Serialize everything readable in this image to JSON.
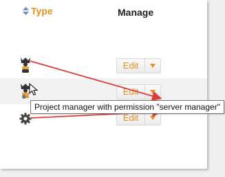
{
  "header": {
    "type_label": "Type",
    "manage_label": "Manage"
  },
  "rows": [
    {
      "type_icon": "project-manager-icon",
      "edit_label": "Edit",
      "caret": "▼"
    },
    {
      "type_icon": "project-manager-server-icon",
      "edit_label": "Edit",
      "caret": "▼"
    },
    {
      "type_icon": "gear-icon",
      "edit_label": "Edit",
      "caret": "▼"
    }
  ],
  "tooltip": {
    "text": "Project manager with permission \"server manager\""
  },
  "colors": {
    "accent": "#e8901f",
    "annotation_arrow": "#e03a3a",
    "row_alt": "#f2f2f2"
  }
}
